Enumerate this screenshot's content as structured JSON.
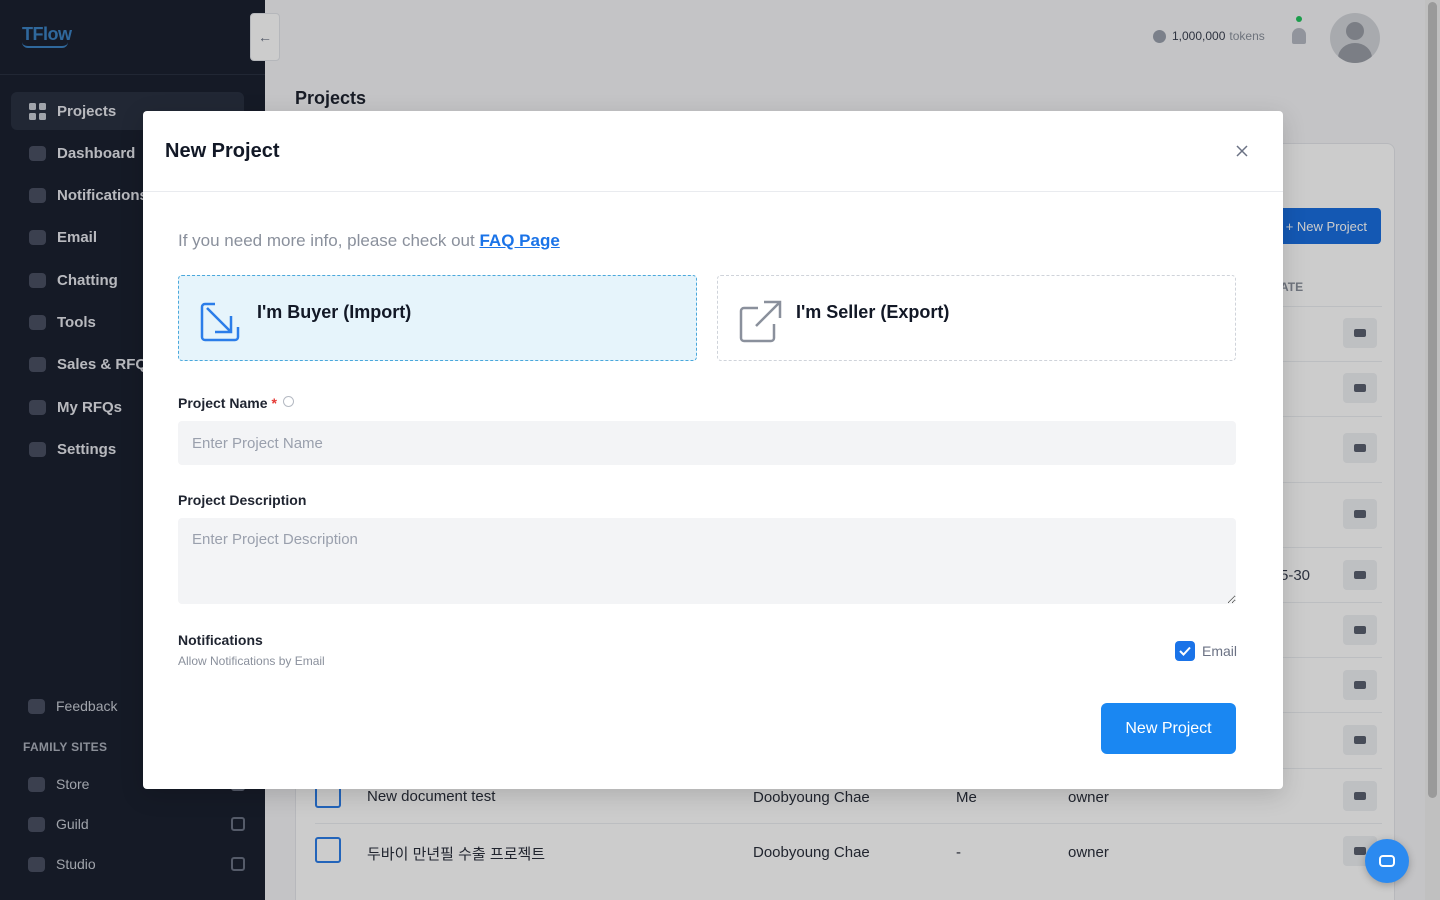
{
  "brand": {
    "logo_text": "TFlow",
    "accent": "#1a87f2",
    "sidebar_bg": "#1b2130"
  },
  "sidebar": {
    "items": [
      {
        "label": "Projects",
        "icon": "grid-icon",
        "active": true
      },
      {
        "label": "Dashboard",
        "icon": "dashboard-icon"
      },
      {
        "label": "Notifications",
        "icon": "bell-icon"
      },
      {
        "label": "Email",
        "icon": "mail-icon"
      },
      {
        "label": "Chatting",
        "icon": "chat-icon"
      },
      {
        "label": "Tools",
        "icon": "wrench-icon"
      },
      {
        "label": "Sales & RFQs",
        "icon": "briefcase-icon"
      },
      {
        "label": "My RFQs",
        "icon": "document-icon"
      },
      {
        "label": "Settings",
        "icon": "gear-icon"
      }
    ],
    "feedback_label": "Feedback",
    "family_sites_title": "FAMILY SITES",
    "family_sites": [
      {
        "label": "Store"
      },
      {
        "label": "Guild"
      },
      {
        "label": "Studio"
      }
    ]
  },
  "topbar": {
    "tokens_value": "1,000,000",
    "tokens_unit": "tokens"
  },
  "page": {
    "title": "Projects",
    "new_project_label": "+ New Project",
    "date_column_partial": "ATE",
    "date_partial": "5-30",
    "rows": [
      {
        "name": "New document test",
        "owner": "Doobyoung Chae",
        "shared": "Me",
        "role": "owner"
      },
      {
        "name": "두바이 만년필 수출 프로젝트",
        "owner": "Doobyoung Chae",
        "shared": "-",
        "role": "owner"
      }
    ]
  },
  "modal": {
    "title": "New Project",
    "info_text": "If you need more info, please check out",
    "faq_link": "FAQ Page",
    "buyer_label": "I'm Buyer (Import)",
    "seller_label": "I'm Seller (Export)",
    "project_name_label": "Project Name",
    "project_name_required": "*",
    "project_name_placeholder": "Enter Project Name",
    "project_description_label": "Project Description",
    "project_description_placeholder": "Enter Project Description",
    "notifications_title": "Notifications",
    "notifications_subtitle": "Allow Notifications by Email",
    "email_checkbox_label": "Email",
    "email_checked": true,
    "submit_label": "New Project"
  }
}
